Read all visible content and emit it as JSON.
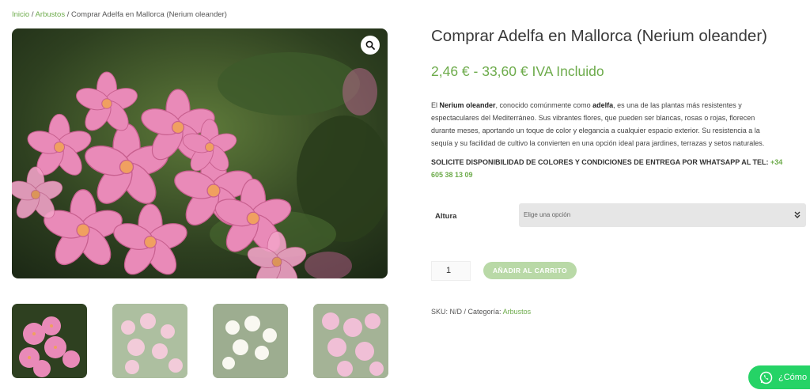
{
  "breadcrumb": {
    "home": "Inicio",
    "sep": " / ",
    "category": "Arbustos",
    "current": "Comprar Adelfa en Mallorca (Nerium oleander)"
  },
  "product": {
    "title": "Comprar Adelfa en Mallorca (Nerium oleander)",
    "price": "2,46 € - 33,60 € IVA Incluido",
    "desc_1": "El ",
    "desc_name": "Nerium oleander",
    "desc_2": ", conocido comúnmente como ",
    "desc_common": "adelfa",
    "desc_3": ", es una de las plantas más resistentes y espectaculares del Mediterráneo. Sus vibrantes flores, que pueden ser blancas, rosas o rojas, florecen durante meses, aportando un toque de color y elegancia a cualquier espacio exterior. Su resistencia a la sequía y su facilidad de cultivo la convierten en una opción ideal para jardines, terrazas y setos naturales.",
    "notice": "SOLICITE DISPONIBILIDAD DE COLORES Y CONDICIONES DE ENTREGA POR WHATSAPP AL TEL: ",
    "phone": "+34 605 38 13 09"
  },
  "options": {
    "altura_label": "Altura",
    "select_placeholder": "Elige una opción"
  },
  "cart": {
    "quantity": "1",
    "add_label": "AÑADIR AL CARRITO"
  },
  "meta": {
    "sku": "SKU: N/D",
    "sep": " / ",
    "category_label": "Categoría: ",
    "category": "Arbustos"
  },
  "whatsapp": {
    "label": "¿Cómo"
  },
  "icons": {
    "zoom": "magnifier-icon",
    "select": "chevron-down-icon",
    "whatsapp": "whatsapp-icon"
  },
  "colors": {
    "accent": "#6dab4b",
    "button": "#b9d9a7",
    "whatsapp": "#25d366"
  }
}
